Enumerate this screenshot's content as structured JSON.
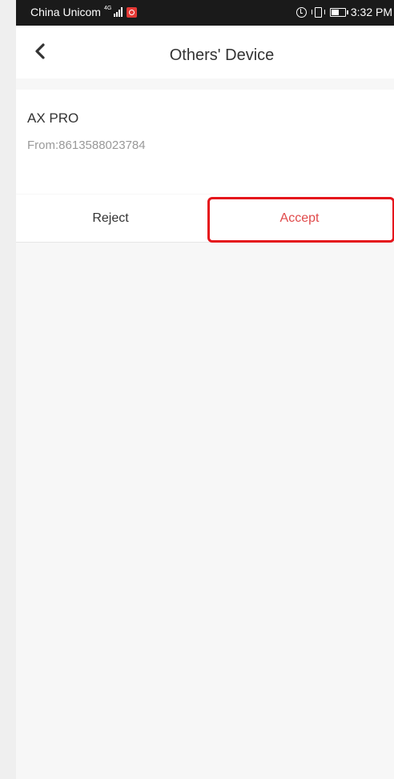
{
  "status_bar": {
    "carrier": "China Unicom",
    "network_type": "4G",
    "time": "3:32 PM"
  },
  "nav": {
    "title": "Others' Device"
  },
  "device": {
    "name": "AX PRO",
    "from": "From:8613588023784"
  },
  "actions": {
    "reject_label": "Reject",
    "accept_label": "Accept"
  },
  "colors": {
    "accent": "#e0494a",
    "highlight": "#e5141b"
  }
}
